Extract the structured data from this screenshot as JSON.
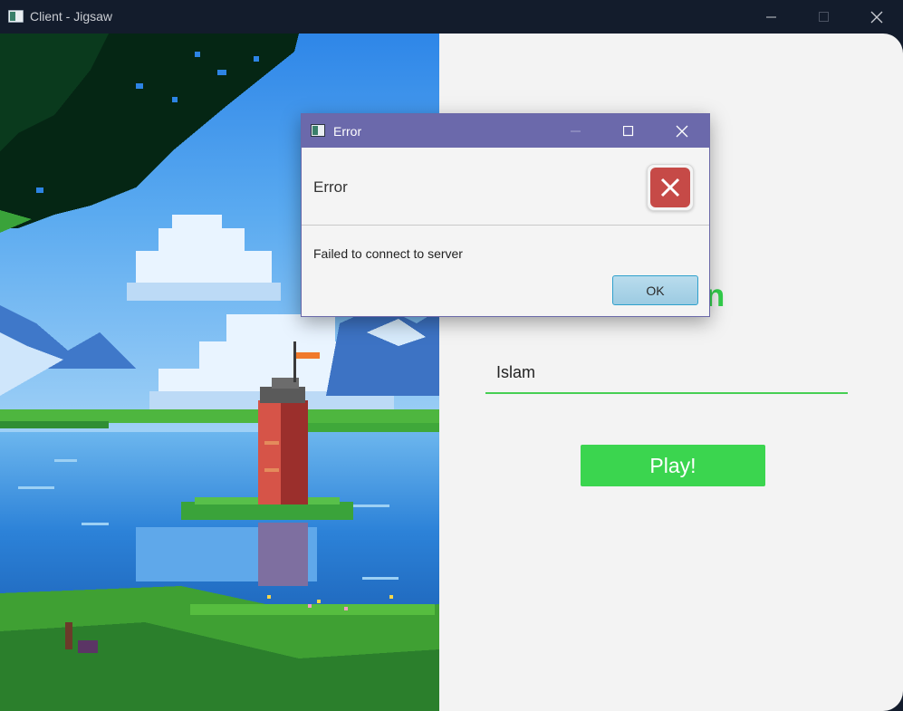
{
  "window": {
    "title": "Client - Jigsaw",
    "controls": {
      "minimize": "minimize-icon",
      "maximize": "maximize-icon",
      "close": "close-icon"
    }
  },
  "login": {
    "title": "Login",
    "name_value": "Islam",
    "play_label": "Play!",
    "accent_color": "#34d14d"
  },
  "dialog": {
    "title": "Error",
    "header_text": "Error",
    "message": "Failed to connect to server",
    "ok_label": "OK",
    "icon": "error-x-icon"
  }
}
